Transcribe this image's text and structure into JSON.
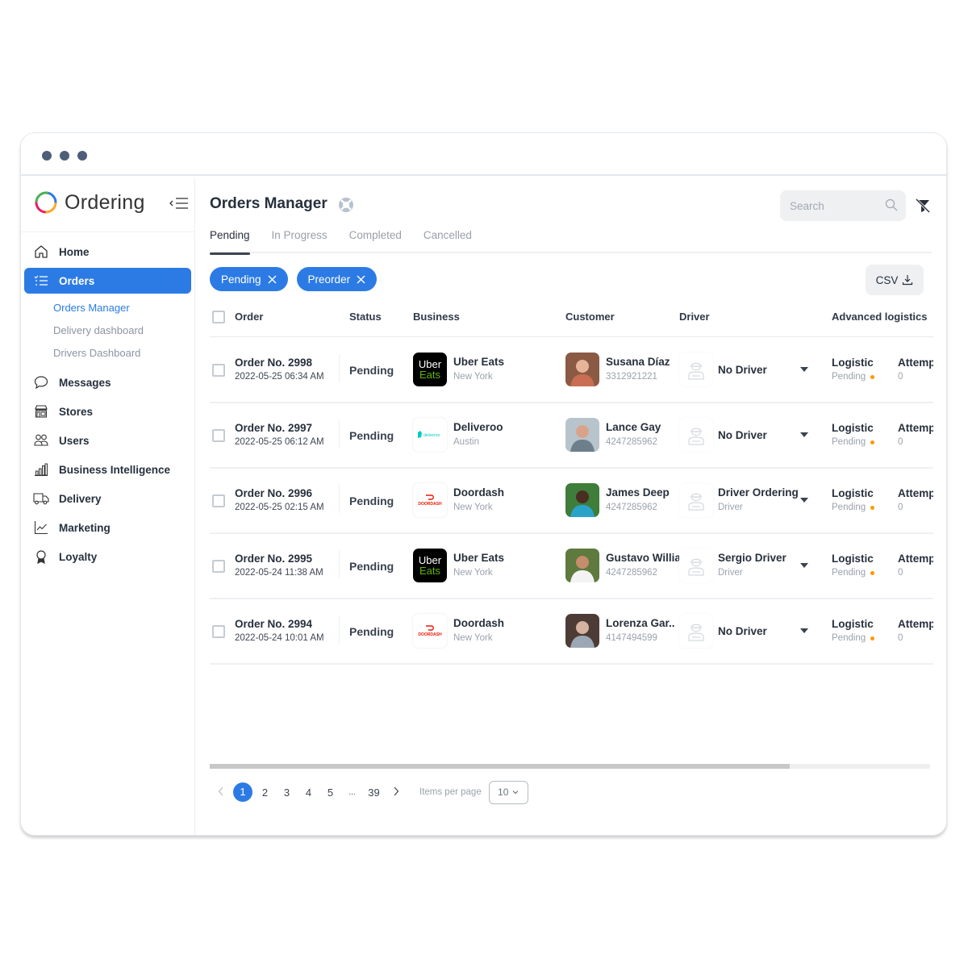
{
  "window": {
    "controls": [
      "dot",
      "dot",
      "dot"
    ]
  },
  "sidebar": {
    "brand": "Ordering",
    "collapse_icon": "collapse-menu-icon",
    "items": [
      {
        "label": "Home",
        "icon": "home-icon",
        "active": false
      },
      {
        "label": "Orders",
        "icon": "list-icon",
        "active": true
      },
      {
        "label": "Messages",
        "icon": "chat-bubble-icon",
        "active": false
      },
      {
        "label": "Stores",
        "icon": "store-icon",
        "active": false
      },
      {
        "label": "Users",
        "icon": "users-icon",
        "active": false
      },
      {
        "label": "Business Intelligence",
        "icon": "bar-chart-icon",
        "active": false
      },
      {
        "label": "Delivery",
        "icon": "truck-icon",
        "active": false
      },
      {
        "label": "Marketing",
        "icon": "line-chart-icon",
        "active": false
      },
      {
        "label": "Loyalty",
        "icon": "award-icon",
        "active": false
      }
    ],
    "orders_subitems": [
      {
        "label": "Orders Manager",
        "active": true
      },
      {
        "label": "Delivery dashboard",
        "active": false
      },
      {
        "label": "Drivers Dashboard",
        "active": false
      }
    ]
  },
  "header": {
    "title": "Orders Manager",
    "help_icon": "lifebuoy-icon",
    "search_placeholder": "Search",
    "search_value": "",
    "filter_clear_icon": "filter-off-icon"
  },
  "tabs": [
    {
      "label": "Pending",
      "active": true
    },
    {
      "label": "In Progress",
      "active": false
    },
    {
      "label": "Completed",
      "active": false
    },
    {
      "label": "Cancelled",
      "active": false
    }
  ],
  "filter_chips": [
    {
      "label": "Pending"
    },
    {
      "label": "Preorder"
    }
  ],
  "csv_button": {
    "label": "CSV",
    "icon": "download-icon"
  },
  "table": {
    "columns": [
      "Order",
      "Status",
      "Business",
      "Customer",
      "Driver",
      "Advanced logistics"
    ],
    "rows": [
      {
        "order_no": "Order No. 2998",
        "date": "2022-05-25 06:34 AM",
        "status": "Pending",
        "business": "Uber Eats",
        "business_logo": "uber-eats",
        "city": "New York",
        "customer": "Susana Díaz",
        "phone": "3312921221",
        "driver": "No Driver",
        "driver_role": "",
        "logistic_title": "Logistic",
        "logistic_status": "Pending",
        "attempts_title": "Attempts",
        "attempts": "0"
      },
      {
        "order_no": "Order No. 2997",
        "date": "2022-05-25 06:12 AM",
        "status": "Pending",
        "business": "Deliveroo",
        "business_logo": "deliveroo",
        "city": "Austin",
        "customer": "Lance Gay",
        "phone": "4247285962",
        "driver": "No Driver",
        "driver_role": "",
        "logistic_title": "Logistic",
        "logistic_status": "Pending",
        "attempts_title": "Attempts",
        "attempts": "0"
      },
      {
        "order_no": "Order No. 2996",
        "date": "2022-05-25 02:15 AM",
        "status": "Pending",
        "business": "Doordash",
        "business_logo": "doordash",
        "city": "New York",
        "customer": "James Deep",
        "phone": "4247285962",
        "driver": "Driver Ordering",
        "driver_role": "Driver",
        "logistic_title": "Logistic",
        "logistic_status": "Pending",
        "attempts_title": "Attempts",
        "attempts": "0"
      },
      {
        "order_no": "Order No. 2995",
        "date": "2022-05-24 11:38 AM",
        "status": "Pending",
        "business": "Uber Eats",
        "business_logo": "uber-eats",
        "city": "New York",
        "customer": "Gustavo Willia..",
        "phone": "4247285962",
        "driver": "Sergio Driver",
        "driver_role": "Driver",
        "logistic_title": "Logistic",
        "logistic_status": "Pending",
        "attempts_title": "Attempts",
        "attempts": "0"
      },
      {
        "order_no": "Order No. 2994",
        "date": "2022-05-24 10:01 AM",
        "status": "Pending",
        "business": "Doordash",
        "business_logo": "doordash",
        "city": "New York",
        "customer": "Lorenza Gar..",
        "phone": "4147494599",
        "driver": "No Driver",
        "driver_role": "",
        "logistic_title": "Logistic",
        "logistic_status": "Pending",
        "attempts_title": "Attempts",
        "attempts": "0"
      }
    ],
    "horizontal_scroll_fraction": 0.805
  },
  "pagination": {
    "pages": [
      "1",
      "2",
      "3",
      "4",
      "5",
      "...",
      "39"
    ],
    "current": "1",
    "items_per_page_label": "Items per page",
    "items_per_page_value": "10"
  },
  "colors": {
    "accent": "#2c7be5",
    "text_dark": "#27303c",
    "text_muted": "#9aa2ad",
    "logistic_pending_dot": "#ff9800",
    "uber_green": "#5fb709",
    "doordash_red": "#eb1700",
    "deliveroo_teal": "#00ccbc"
  }
}
